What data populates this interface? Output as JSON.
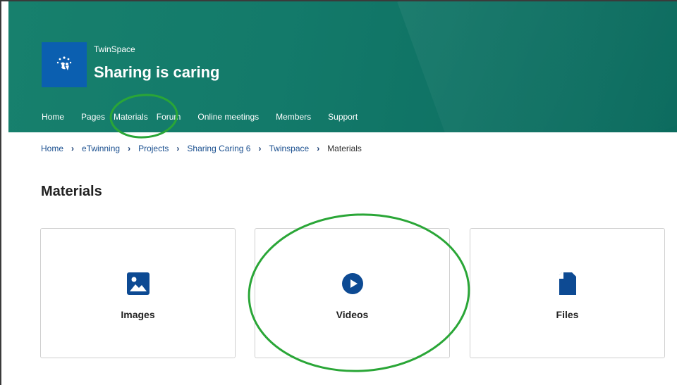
{
  "header": {
    "space_label": "TwinSpace",
    "title": "Sharing is caring"
  },
  "nav": {
    "items": [
      {
        "label": "Home"
      },
      {
        "label": "Pages"
      },
      {
        "label": "Materials"
      },
      {
        "label": "Forum"
      },
      {
        "label": "Online meetings"
      },
      {
        "label": "Members"
      },
      {
        "label": "Support"
      }
    ]
  },
  "breadcrumb": {
    "items": [
      {
        "label": "Home"
      },
      {
        "label": "eTwinning"
      },
      {
        "label": "Projects"
      },
      {
        "label": "Sharing Caring 6"
      },
      {
        "label": "Twinspace"
      },
      {
        "label": "Materials"
      }
    ]
  },
  "page": {
    "title": "Materials"
  },
  "cards": [
    {
      "label": "Images",
      "icon": "image-icon"
    },
    {
      "label": "Videos",
      "icon": "play-circle-icon"
    },
    {
      "label": "Files",
      "icon": "file-icon"
    }
  ],
  "colors": {
    "header_green": "#137a6a",
    "logo_blue": "#0b5fb0",
    "icon_blue": "#0d4a93",
    "annotation_green": "#2aa637"
  }
}
